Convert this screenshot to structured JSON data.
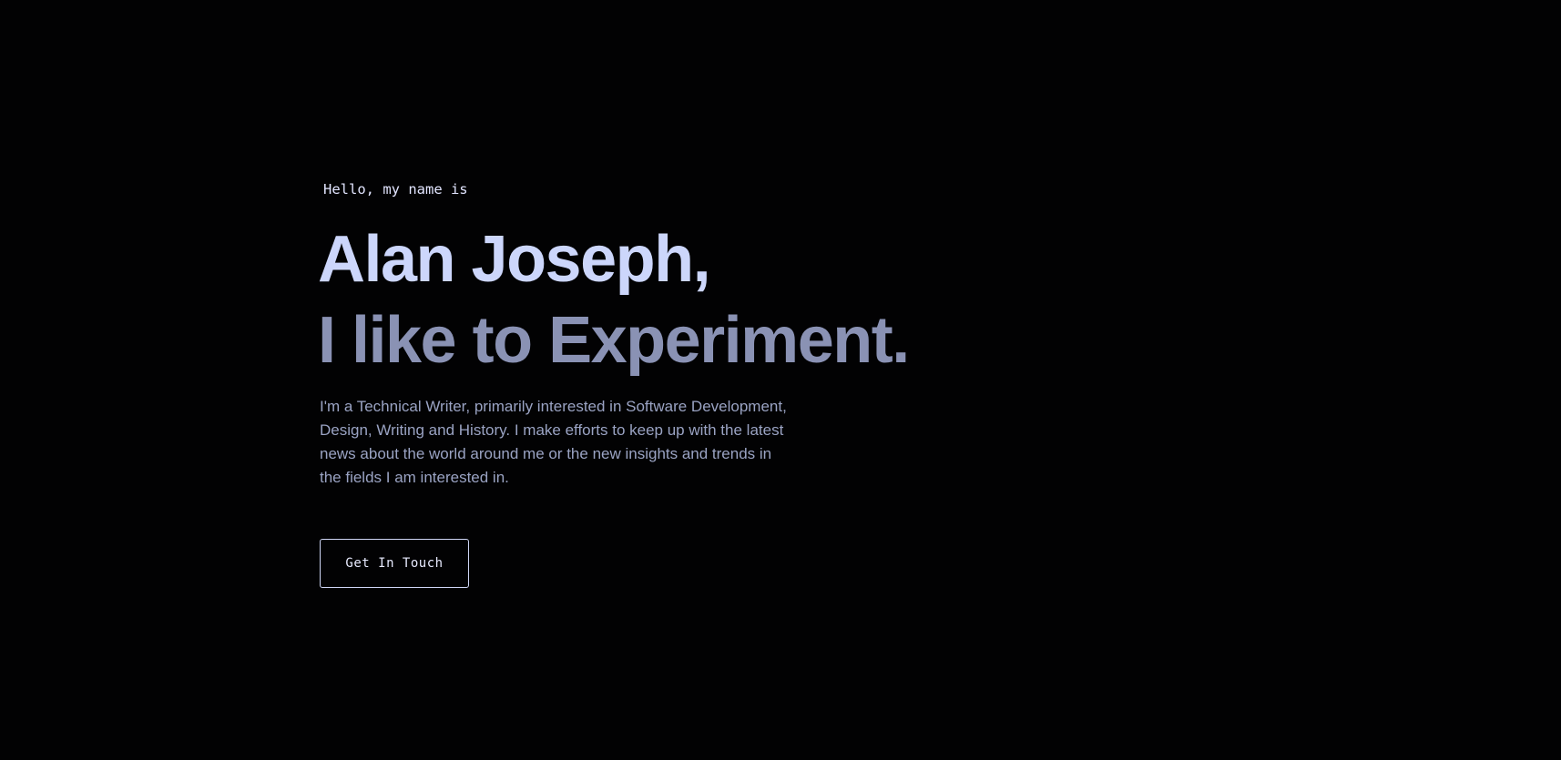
{
  "hero": {
    "greeting": "Hello, my name is",
    "name": "Alan Joseph,",
    "tagline": "I like to Experiment.",
    "bio": "I'm a Technical Writer, primarily interested in Software Development, Design, Writing and History. I make efforts to keep up with the latest news about the world around me or the new insights and trends in the fields I am interested in.",
    "cta_label": "Get In Touch"
  },
  "colors": {
    "background": "#020203",
    "name": "#ccd6fb",
    "tagline": "#8a92b4",
    "body_text": "#9aa3c3",
    "button_border": "#cfd6f6"
  }
}
